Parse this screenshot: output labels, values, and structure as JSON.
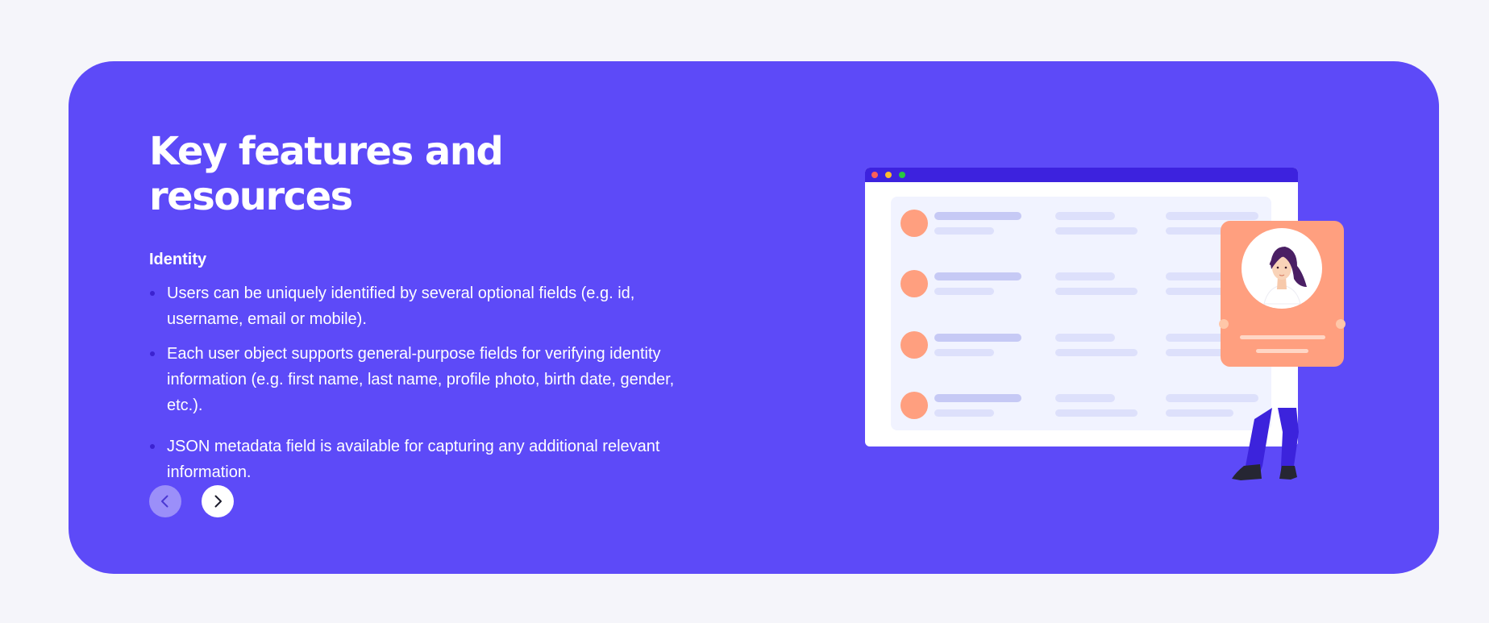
{
  "section": {
    "title": "Key features and resources",
    "subtitle": "Identity",
    "features": [
      "Users can be uniquely identified by several optional fields (e.g. id, username, email or mobile).",
      "Each user object supports general-purpose fields for verifying identity information (e.g. first name, last name, profile photo, birth date, gender, etc.).",
      "JSON metadata field is available for capturing any additional relevant information."
    ]
  },
  "navigation": {
    "prev_icon": "chevron-left-icon",
    "next_icon": "chevron-right-icon"
  },
  "colors": {
    "page_background": "#f5f5fa",
    "card_background": "#5d4af8",
    "window_bar": "#3d22de",
    "accent_orange": "#ff9f7f",
    "bullet": "#3b22d0"
  }
}
